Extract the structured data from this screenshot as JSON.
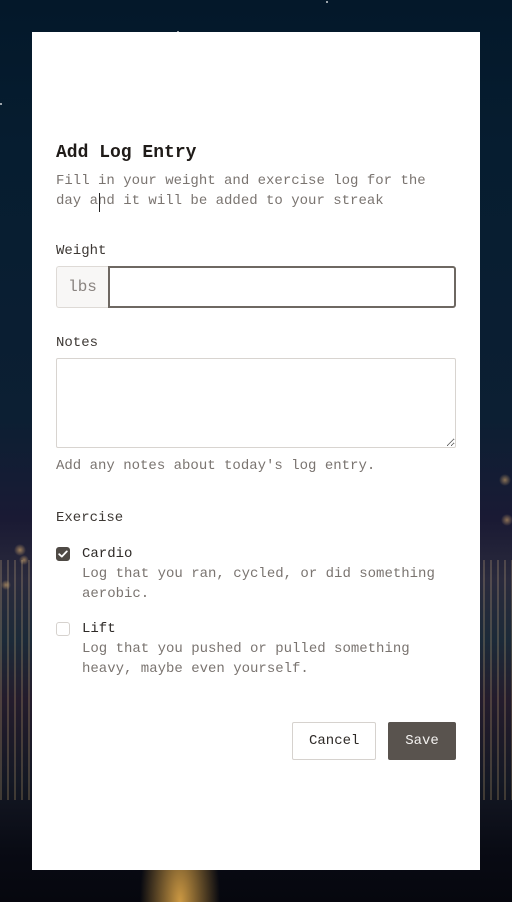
{
  "dialog": {
    "title": "Add Log Entry",
    "subtitle": "Fill in your weight and exercise log for the day and it will be added to your streak"
  },
  "weight": {
    "label": "Weight",
    "unit": "lbs",
    "value": "",
    "placeholder": ""
  },
  "notes": {
    "label": "Notes",
    "value": "",
    "help": "Add any notes about today's log entry."
  },
  "exercise": {
    "label": "Exercise",
    "options": [
      {
        "title": "Cardio",
        "description": "Log that you ran, cycled, or did something aerobic.",
        "checked": true
      },
      {
        "title": "Lift",
        "description": "Log that you pushed or pulled something heavy, maybe even yourself.",
        "checked": false
      }
    ]
  },
  "actions": {
    "cancel_label": "Cancel",
    "save_label": "Save"
  },
  "colors": {
    "primary_button": "#59534e",
    "checkbox_checked": "#4f4a45",
    "modal_background": "#ffffff"
  }
}
